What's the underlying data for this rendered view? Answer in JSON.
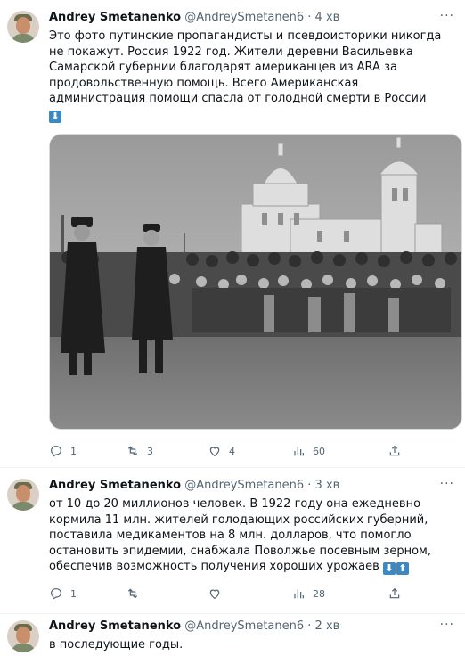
{
  "tweets": [
    {
      "author_name": "Andrey Smetanenko",
      "handle": "@AndreySmetanen6",
      "separator": "·",
      "time": "4 хв",
      "text": "Это фото путинские пропагандисты и псевдоисторики никогда не покажут. Россия 1922 год. Жители деревни Васильевка Самарской губернии благодарят американцев из ARA за продовольственную помощь. Всего Американская администрация помощи спасла от голодной смерти в России",
      "emojis": [
        "⬇"
      ],
      "reply_count": "1",
      "retweet_count": "3",
      "like_count": "4",
      "views_count": "60"
    },
    {
      "author_name": "Andrey Smetanenko",
      "handle": "@AndreySmetanen6",
      "separator": "·",
      "time": "3 хв",
      "text": "от 10 до 20 миллионов человек. В 1922 году она ежедневно кормила 11 млн. жителей голодающих российских губерний, поставила медикаментов на 8 млн. долларов, что помогло остановить эпидемии, снабжала Поволжье посевным зерном, обеспечив возможность получения хороших урожаев",
      "emojis": [
        "⬇",
        "⬆"
      ],
      "reply_count": "1",
      "retweet_count": "",
      "like_count": "",
      "views_count": "28"
    },
    {
      "author_name": "Andrey Smetanenko",
      "handle": "@AndreySmetanen6",
      "separator": "·",
      "time": "2 хв",
      "text": "в последующие годы."
    }
  ],
  "more_label": "···",
  "colors": {
    "text": "#0f1419",
    "secondary": "#536471",
    "divider": "#eff3f4",
    "emoji_blue": "#3b88c3"
  }
}
